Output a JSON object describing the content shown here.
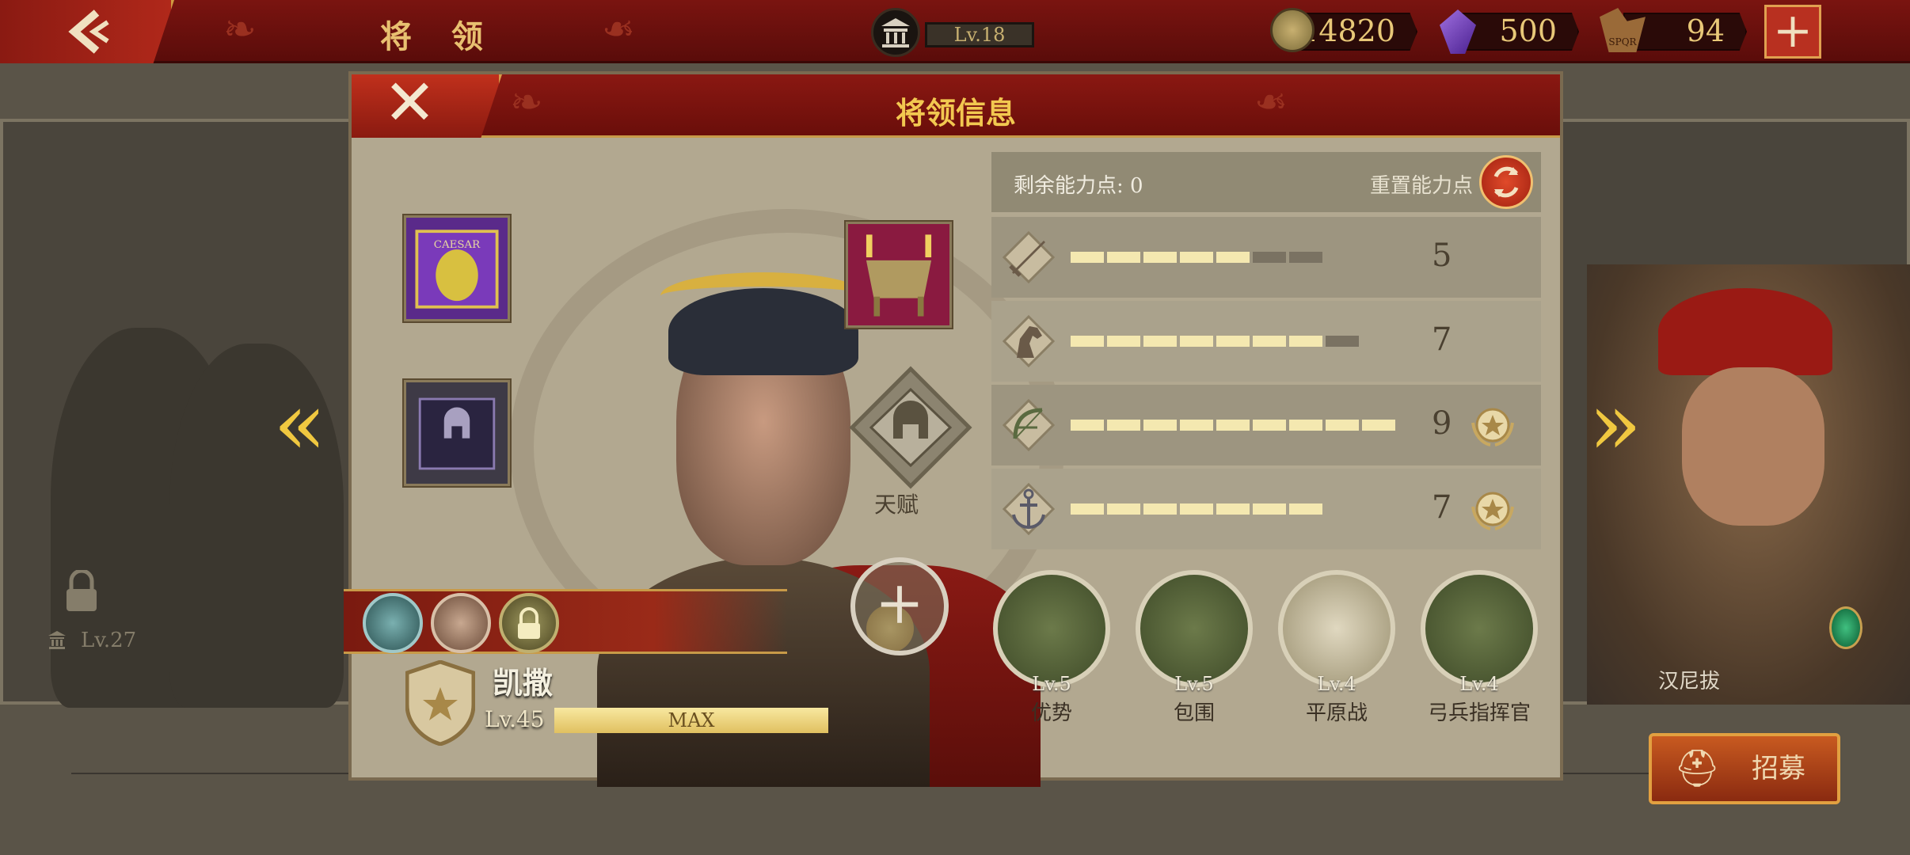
{
  "top_bar": {
    "title": "将 领",
    "player_level": "Lv.18",
    "resources": [
      {
        "icon": "gold-coin-icon",
        "value": "14820"
      },
      {
        "icon": "purple-gem-icon",
        "value": "500"
      },
      {
        "icon": "spqr-token-icon",
        "value": "94"
      }
    ],
    "add_label": "+"
  },
  "side": {
    "left_locked_level": "Lv.27",
    "right_general_name": "汉尼拔"
  },
  "recruit": {
    "label": "招募"
  },
  "dialog": {
    "title": "将领信息",
    "close_label": "✕",
    "talent_label": "天赋",
    "general": {
      "name": "凯撒",
      "level": "Lv.45",
      "exp_label": "MAX",
      "exp_fraction": 1.0
    },
    "stats_header": {
      "remaining_label": "剩余能力点: 0",
      "reset_label": "重置能力点"
    },
    "stats": [
      {
        "icon": "sword-icon",
        "value": "5",
        "filled": 5,
        "total": 7,
        "starred": false
      },
      {
        "icon": "horse-icon",
        "value": "7",
        "filled": 7,
        "total": 8,
        "starred": false
      },
      {
        "icon": "bow-icon",
        "value": "9",
        "filled": 9,
        "total": 9,
        "starred": true
      },
      {
        "icon": "anchor-icon",
        "value": "7",
        "filled": 7,
        "total": 7,
        "starred": true
      }
    ],
    "skills": [
      {
        "level": "Lv.5",
        "name": "优势"
      },
      {
        "level": "Lv.5",
        "name": "包围"
      },
      {
        "level": "Lv.4",
        "name": "平原战"
      },
      {
        "level": "Lv.4",
        "name": "弓兵指挥官"
      }
    ],
    "equipment_banner_text": "CAESAR"
  }
}
